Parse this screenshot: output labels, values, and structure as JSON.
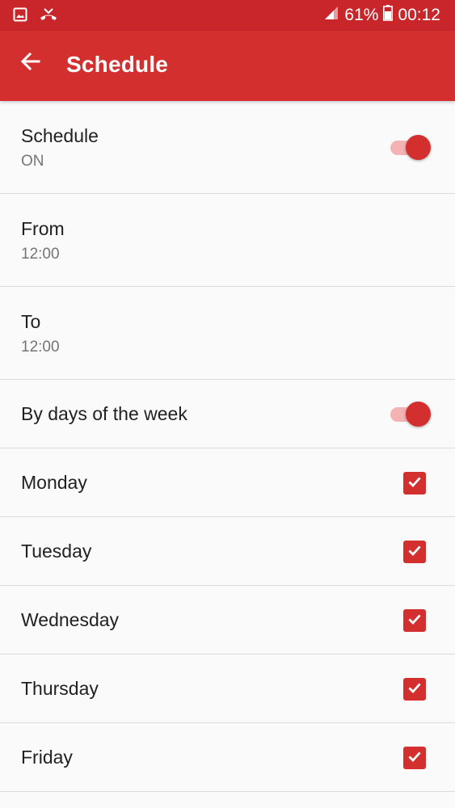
{
  "status_bar": {
    "battery": "61%",
    "time": "00:12",
    "icons": [
      "gallery-icon",
      "missed-call-icon",
      "signal-icon",
      "battery-icon"
    ]
  },
  "app_bar": {
    "title": "Schedule",
    "back_icon": "arrow-left-icon",
    "background": "#d32f2f"
  },
  "settings": {
    "schedule": {
      "label": "Schedule",
      "value": "ON",
      "enabled": true
    },
    "from": {
      "label": "From",
      "value": "12:00"
    },
    "to": {
      "label": "To",
      "value": "12:00"
    },
    "by_days": {
      "label": "By days of the week",
      "enabled": true
    },
    "days": [
      {
        "label": "Monday",
        "checked": true
      },
      {
        "label": "Tuesday",
        "checked": true
      },
      {
        "label": "Wednesday",
        "checked": true
      },
      {
        "label": "Thursday",
        "checked": true
      },
      {
        "label": "Friday",
        "checked": true
      }
    ]
  },
  "colors": {
    "accent": "#d32f2f",
    "status_bar": "#c8262a",
    "switch_track": "#f4b3b3"
  }
}
